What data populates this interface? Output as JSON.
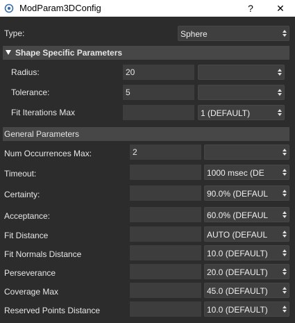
{
  "window": {
    "title": "ModParam3DConfig",
    "help_label": "?",
    "close_label": "✕"
  },
  "type_row": {
    "label": "Type:",
    "value": "Sphere"
  },
  "shape_section": {
    "title": "Shape Specific Parameters",
    "rows": [
      {
        "label": "Radius:",
        "value": "20",
        "option": ""
      },
      {
        "label": "Tolerance:",
        "value": "5",
        "option": ""
      },
      {
        "label": "Fit Iterations Max",
        "value": "",
        "option": "1 (DEFAULT)"
      }
    ]
  },
  "general_section": {
    "title": "General Parameters",
    "rows": [
      {
        "label": "Num Occurrences Max:",
        "value": "2",
        "option": ""
      },
      {
        "label": "Timeout:",
        "value": "",
        "option": "1000 msec (DE"
      },
      {
        "label": "Certainty:",
        "value": "",
        "option": "90.0% (DEFAUL"
      },
      {
        "label": "Acceptance:",
        "value": "",
        "option": "60.0% (DEFAUL"
      },
      {
        "label": "Fit Distance",
        "value": "",
        "option": "AUTO (DEFAUL"
      },
      {
        "label": "Fit Normals Distance",
        "value": "",
        "option": "10.0 (DEFAULT)"
      },
      {
        "label": "Perseverance",
        "value": "",
        "option": "20.0 (DEFAULT)"
      },
      {
        "label": "Coverage Max",
        "value": "",
        "option": "45.0 (DEFAULT)"
      },
      {
        "label": "Reserved Points Distance",
        "value": "",
        "option": "10.0 (DEFAULT)"
      }
    ]
  }
}
